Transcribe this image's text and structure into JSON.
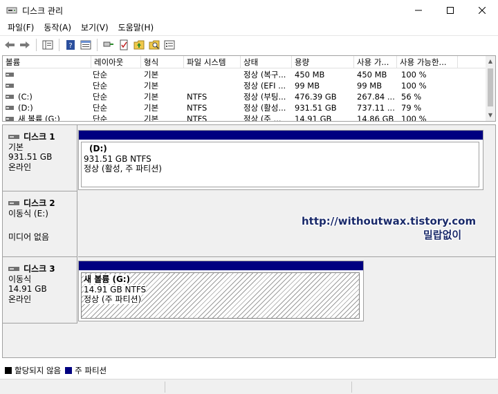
{
  "window": {
    "title": "디스크 관리",
    "minimize": "–",
    "maximize": "□",
    "close": "✕"
  },
  "menu": [
    "파일(F)",
    "동작(A)",
    "보기(V)",
    "도움말(H)"
  ],
  "toolbar": {
    "icons": [
      "back-arrow-icon",
      "forward-arrow-icon",
      "console-tree-icon",
      "help-icon",
      "properties-icon",
      "connect-icon",
      "check-icon",
      "up-icon",
      "search-icon",
      "list-icon"
    ]
  },
  "volume_list": {
    "headers": [
      "볼륨",
      "레이아웃",
      "형식",
      "파일 시스템",
      "상태",
      "용량",
      "사용 가...",
      "사용 가능한..."
    ],
    "rows": [
      [
        "",
        "단순",
        "기본",
        "",
        "정상 (복구...",
        "450 MB",
        "450 MB",
        "100 %"
      ],
      [
        "",
        "단순",
        "기본",
        "",
        "정상 (EFI ...",
        "99 MB",
        "99 MB",
        "100 %"
      ],
      [
        "(C:)",
        "단순",
        "기본",
        "NTFS",
        "정상 (부팅...",
        "476.39 GB",
        "267.84 ...",
        "56 %"
      ],
      [
        "(D:)",
        "단순",
        "기본",
        "NTFS",
        "정상 (활성...",
        "931.51 GB",
        "737.11 ...",
        "79 %"
      ],
      [
        "새 볼륨 (G:)",
        "단순",
        "기본",
        "NTFS",
        "정상 (주 ...",
        "14.91 GB",
        "14.86 GB",
        "100 %"
      ]
    ]
  },
  "disks": [
    {
      "name": "디스크 1",
      "type": "기본",
      "size": "931.51 GB",
      "status": "온라인",
      "partition": {
        "name": "(D:)",
        "size_fs": "931.51 GB NTFS",
        "status": "정상 (활성, 주 파티션)"
      }
    },
    {
      "name": "디스크 2",
      "type": "이동식 (E:)",
      "size": "",
      "status": "미디어 없음"
    },
    {
      "name": "디스크 3",
      "type": "이동식",
      "size": "14.91 GB",
      "status": "온라인",
      "partition": {
        "name": "새 볼륨  (G:)",
        "size_fs": "14.91 GB NTFS",
        "status": "정상 (주 파티션)"
      }
    }
  ],
  "watermark": {
    "url": "http://withoutwax.tistory.com",
    "text": "밀랍없이"
  },
  "legend": {
    "items": [
      {
        "label": "할당되지 않음",
        "color": "#000000"
      },
      {
        "label": "주 파티션",
        "color": "#000080"
      }
    ]
  }
}
